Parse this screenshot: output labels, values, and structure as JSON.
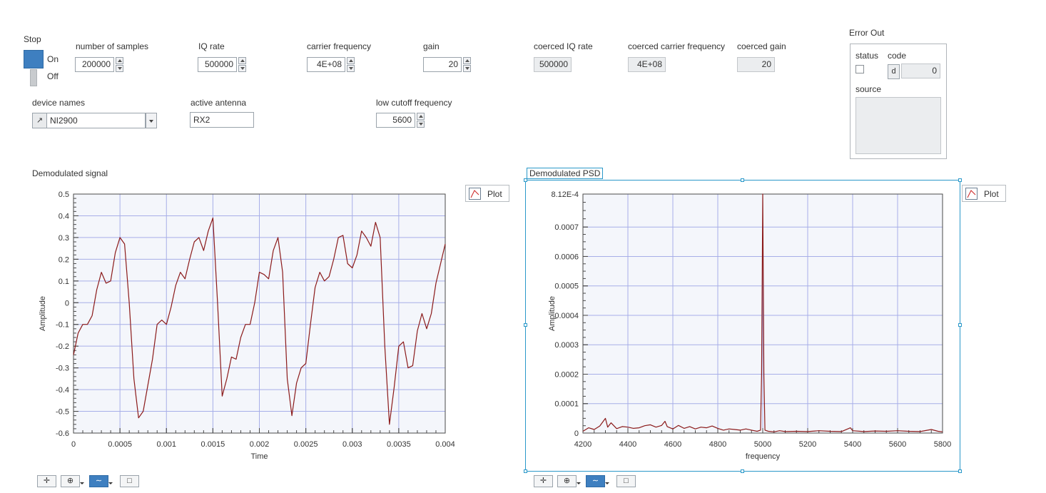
{
  "stop": {
    "label": "Stop",
    "on": "On",
    "off": "Off"
  },
  "controls": {
    "num_samples": {
      "label": "number of samples",
      "value": "200000"
    },
    "iq_rate": {
      "label": "IQ rate",
      "value": "500000"
    },
    "carrier_freq": {
      "label": "carrier frequency",
      "value": "4E+08"
    },
    "gain": {
      "label": "gain",
      "value": "20"
    },
    "coerced_iq_rate": {
      "label": "coerced IQ rate",
      "value": "500000"
    },
    "coerced_carrier": {
      "label": "coerced carrier frequency",
      "value": "4E+08"
    },
    "coerced_gain": {
      "label": "coerced gain",
      "value": "20"
    },
    "device_names": {
      "label": "device names",
      "value": "NI2900"
    },
    "active_antenna": {
      "label": "active antenna",
      "value": "RX2"
    },
    "low_cutoff": {
      "label": "low cutoff frequency",
      "value": "5600"
    }
  },
  "error_out": {
    "title": "Error Out",
    "status_label": "status",
    "code_label": "code",
    "code_value": "0",
    "source_label": "source",
    "code_icon": "d"
  },
  "colors": {
    "trace": "#8b1a1a",
    "plot_bg": "#f4f6fb",
    "grid": "#a7aee8",
    "selection": "#2a98c9",
    "toggle": "#3e7fc0"
  },
  "graph1": {
    "title": "Demodulated signal",
    "plot_button": "Plot",
    "xlabel": "Time",
    "ylabel": "Amplitude",
    "xticks": [
      "0",
      "0.0005",
      "0.001",
      "0.0015",
      "0.002",
      "0.0025",
      "0.003",
      "0.0035",
      "0.004"
    ],
    "yticks": [
      "0.5",
      "0.4",
      "0.3",
      "0.2",
      "0.1",
      "0",
      "-0.1",
      "-0.2",
      "-0.3",
      "-0.4",
      "-0.5",
      "-0.6"
    ]
  },
  "graph2": {
    "title": "Demodulated PSD",
    "plot_button": "Plot",
    "xlabel": "frequency",
    "ylabel": "Amplitude",
    "xticks": [
      "4200",
      "4400",
      "4600",
      "4800",
      "5000",
      "5200",
      "5400",
      "5600",
      "5800"
    ],
    "yticks": [
      "8.12E-4",
      "0.0007",
      "0.0006",
      "0.0005",
      "0.0004",
      "0.0003",
      "0.0002",
      "0.0001",
      "0"
    ]
  },
  "toolbar_icons": [
    "cursor-icon",
    "zoom-icon",
    "pan-icon",
    "autoscale-icon"
  ],
  "chart_data": [
    {
      "type": "line",
      "title": "Demodulated signal",
      "xlabel": "Time",
      "ylabel": "Amplitude",
      "xlim": [
        0,
        0.004
      ],
      "ylim": [
        -0.6,
        0.5
      ],
      "grid": true,
      "series": [
        {
          "x": [
            0,
            5e-05,
            0.0001,
            0.00015,
            0.0002,
            0.00025,
            0.0003,
            0.00035,
            0.0004,
            0.00045,
            0.0005,
            0.00055,
            0.0006,
            0.00065,
            0.0007,
            0.00075,
            0.0008,
            0.00085,
            0.0009,
            0.00095,
            0.001,
            0.00105,
            0.0011,
            0.00115,
            0.0012,
            0.00125,
            0.0013,
            0.00135,
            0.0014,
            0.00145,
            0.0015,
            0.00155,
            0.0016,
            0.00165,
            0.0017,
            0.00175,
            0.0018,
            0.00185,
            0.0019,
            0.00195,
            0.002,
            0.00205,
            0.0021,
            0.00215,
            0.0022,
            0.00225,
            0.0023,
            0.00235,
            0.0024,
            0.00245,
            0.0025,
            0.00255,
            0.0026,
            0.00265,
            0.0027,
            0.00275,
            0.0028,
            0.00285,
            0.0029,
            0.00295,
            0.003,
            0.00305,
            0.0031,
            0.00315,
            0.0032,
            0.00325,
            0.0033,
            0.00335,
            0.0034,
            0.00345,
            0.0035,
            0.00355,
            0.0036,
            0.00365,
            0.0037,
            0.00375,
            0.0038,
            0.00385,
            0.0039,
            0.00395,
            0.004
          ],
          "y": [
            -0.24,
            -0.14,
            -0.1,
            -0.1,
            -0.06,
            0.06,
            0.14,
            0.09,
            0.1,
            0.23,
            0.3,
            0.27,
            0.0,
            -0.35,
            -0.53,
            -0.5,
            -0.38,
            -0.26,
            -0.1,
            -0.08,
            -0.1,
            -0.02,
            0.08,
            0.14,
            0.11,
            0.2,
            0.28,
            0.3,
            0.24,
            0.33,
            0.39,
            0.0,
            -0.43,
            -0.35,
            -0.25,
            -0.26,
            -0.16,
            -0.1,
            -0.1,
            0.0,
            0.14,
            0.13,
            0.11,
            0.24,
            0.3,
            0.14,
            -0.35,
            -0.52,
            -0.37,
            -0.3,
            -0.28,
            -0.1,
            0.07,
            0.14,
            0.1,
            0.12,
            0.2,
            0.3,
            0.31,
            0.18,
            0.16,
            0.22,
            0.33,
            0.3,
            0.26,
            0.37,
            0.3,
            -0.2,
            -0.56,
            -0.39,
            -0.2,
            -0.18,
            -0.3,
            -0.29,
            -0.13,
            -0.05,
            -0.12,
            -0.05,
            0.09,
            0.18,
            0.27
          ]
        }
      ]
    },
    {
      "type": "line",
      "title": "Demodulated PSD",
      "xlabel": "frequency",
      "ylabel": "Amplitude",
      "xlim": [
        4200,
        5800
      ],
      "ylim": [
        0,
        0.000812
      ],
      "grid": true,
      "series": [
        {
          "x": [
            4200,
            4225,
            4250,
            4275,
            4300,
            4310,
            4325,
            4350,
            4375,
            4400,
            4425,
            4450,
            4475,
            4500,
            4525,
            4550,
            4565,
            4575,
            4600,
            4625,
            4650,
            4675,
            4700,
            4725,
            4750,
            4775,
            4800,
            4825,
            4850,
            4875,
            4900,
            4925,
            4950,
            4975,
            4990,
            4995,
            5000,
            5005,
            5010,
            5025,
            5050,
            5075,
            5100,
            5150,
            5200,
            5250,
            5300,
            5350,
            5390,
            5400,
            5450,
            5500,
            5550,
            5600,
            5650,
            5700,
            5750,
            5780,
            5800
          ],
          "y": [
            6e-06,
            1.8e-05,
            1.2e-05,
            2.4e-05,
            5e-05,
            2e-05,
            3.5e-05,
            1.5e-05,
            2.2e-05,
            2e-05,
            1.6e-05,
            1.8e-05,
            2.5e-05,
            2.8e-05,
            2e-05,
            2.6e-05,
            4e-05,
            2.2e-05,
            1.4e-05,
            2.6e-05,
            1.6e-05,
            2.2e-05,
            1.4e-05,
            2e-05,
            1.8e-05,
            2.4e-05,
            1.6e-05,
            1e-05,
            1.4e-05,
            1.2e-05,
            1e-05,
            1.4e-05,
            1e-05,
            6e-06,
            1e-05,
            0.0002,
            0.000812,
            0.0002,
            1e-05,
            6e-06,
            4e-06,
            8e-06,
            5e-06,
            6e-06,
            5e-06,
            8e-06,
            6e-06,
            5e-06,
            1.8e-05,
            8e-06,
            5e-06,
            7e-06,
            6e-06,
            8e-06,
            6e-06,
            5e-06,
            1.2e-05,
            6e-06,
            4e-06
          ]
        }
      ]
    }
  ]
}
